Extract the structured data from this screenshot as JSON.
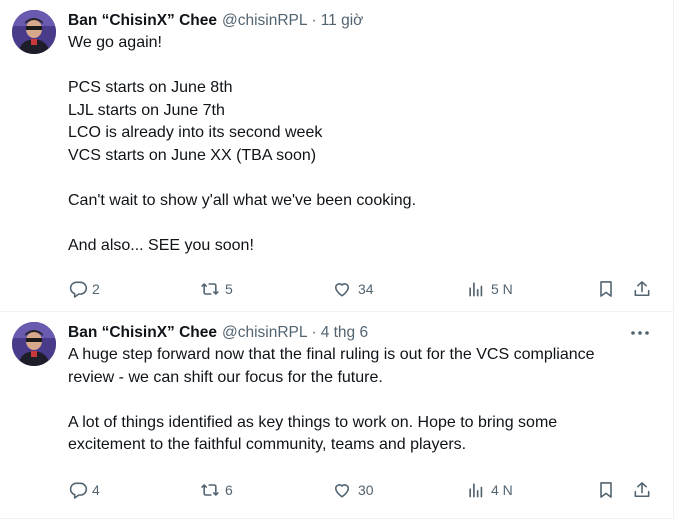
{
  "tweets": [
    {
      "author_name": "Ban “ChisinX” Chee",
      "handle": "@chisinRPL",
      "separator": "·",
      "time": "11 giờ",
      "lines": [
        "We go again!",
        "",
        "PCS starts on June 8th",
        "LJL starts on June 7th",
        "LCO is already into its second week",
        "VCS starts on June XX (TBA soon)",
        "",
        "Can't wait to show y'all what we've been cooking.",
        "",
        "And also... SEE you soon!"
      ],
      "replies": "2",
      "reposts": "5",
      "likes": "34",
      "views": "5 N",
      "show_more_menu": false
    },
    {
      "author_name": "Ban “ChisinX” Chee",
      "handle": "@chisinRPL",
      "separator": "·",
      "time": "4 thg 6",
      "lines": [
        "A huge step forward now that the final ruling is out for the VCS compliance",
        "review - we can shift our focus for the future.",
        "",
        "A lot of things identified as key things to work on. Hope to bring some",
        "excitement to the faithful community, teams and players."
      ],
      "replies": "4",
      "reposts": "6",
      "likes": "30",
      "views": "4 N",
      "show_more_menu": true,
      "more_icon": "more-horizontal-icon"
    }
  ],
  "colors": {
    "text": "#0f1419",
    "secondary": "#536471",
    "border": "#eff3f4"
  }
}
